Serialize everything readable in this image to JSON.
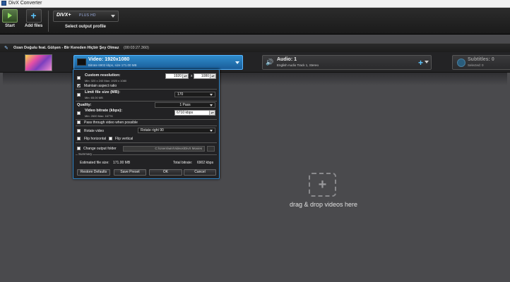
{
  "window": {
    "title": "DivX Converter"
  },
  "toolbar": {
    "start_label": "Start",
    "add_files_label": "Add files",
    "profile_logo": "DIVX+",
    "profile_sub": "PLUS HD",
    "profile_label": "Select output profile"
  },
  "file": {
    "name": "Ozan Doğulu feat. Gülşen - Bir Kereden Hiçbir Şey Olmaz",
    "duration": "(00:03:27.360)"
  },
  "video": {
    "title": "Video: 1920x1080",
    "detail": "Bitrate 6902 kbps, size 171.00 MB"
  },
  "audio": {
    "title": "Audio: 1",
    "detail": "English Audio Track 1, Stereo"
  },
  "subtitles": {
    "title": "Subtitles: 0",
    "detail": "Selected: 0"
  },
  "dialog": {
    "custom_resolution": {
      "label": "Custom resolution:",
      "hint": "Min: 320 x 240 Max: 1920 x 1080",
      "width": "1920",
      "height": "1080",
      "separator": "x",
      "checked": false
    },
    "maintain_aspect": {
      "label": "Maintain aspect ratio",
      "checked": true
    },
    "limit_file_size": {
      "label": "Limit file size (MB):",
      "hint": "Min: 65.00 MB",
      "value": "170",
      "checked": false
    },
    "quality": {
      "label": "Quality:",
      "value": "1 Pass"
    },
    "video_bitrate": {
      "label": "Video bitrate (kbps):",
      "hint": "Min: 2600 Max: 16776",
      "value": "6710 kbps",
      "checked": false
    },
    "pass_through": {
      "label": "Pass through video when possible",
      "checked": false
    },
    "rotate_video": {
      "label": "Rotate video",
      "value": "Rotate right 90",
      "checked": false
    },
    "flip_horizontal": {
      "label": "Flip horizontal",
      "checked": false
    },
    "flip_vertical": {
      "label": "Flip vertical",
      "checked": false
    },
    "output_folder": {
      "label": "Change output folder",
      "path": "C:\\Users\\win\\Videos\\DivX Movies",
      "checked": false
    },
    "summary": {
      "caption": "Summary",
      "estimated_label": "Estimated file size:",
      "estimated_value": "171.00 MB",
      "total_label": "Total bitrate:",
      "total_value": "6902 kbps"
    },
    "buttons": {
      "restore": "Restore Defaults",
      "save_preset": "Save Preset",
      "ok": "OK",
      "cancel": "Cancel"
    }
  },
  "dropzone": {
    "text": "drag & drop videos here"
  },
  "colors": {
    "accent": "#2f86c9",
    "background": "#4a4a4d"
  }
}
